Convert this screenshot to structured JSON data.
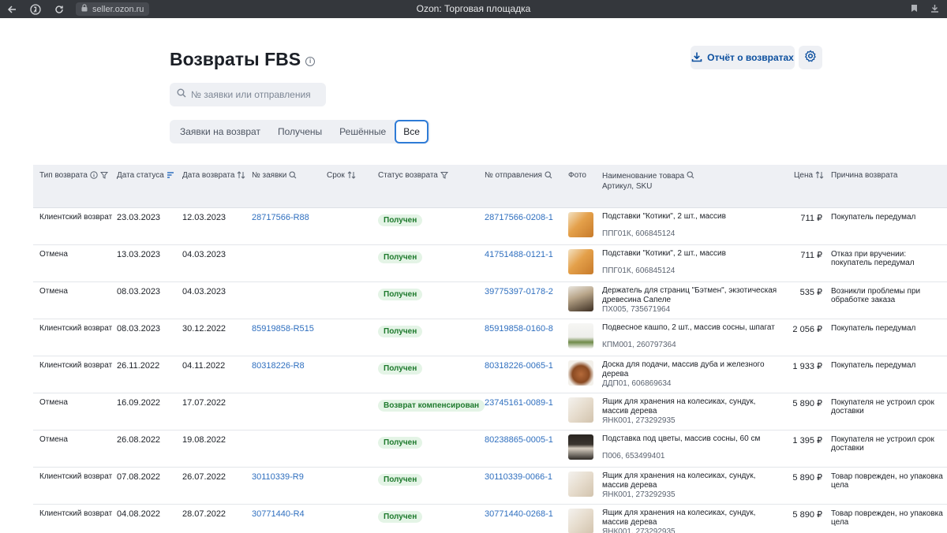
{
  "browser": {
    "url": "seller.ozon.ru",
    "title": "Ozon: Торговая площадка"
  },
  "page": {
    "title": "Возвраты FBS",
    "report_button": "Отчёт о возвратах",
    "search_placeholder": "№ заявки или отправления",
    "tabs": [
      {
        "label": "Заявки на возврат",
        "active": false
      },
      {
        "label": "Получены",
        "active": false
      },
      {
        "label": "Решённые",
        "active": false
      },
      {
        "label": "Все",
        "active": true
      }
    ]
  },
  "table": {
    "headers": {
      "type": "Тип возврата",
      "status_date": "Дата статуса",
      "return_date": "Дата возврата",
      "request_no": "№ заявки",
      "term": "Срок",
      "status": "Статус возврата",
      "shipment_no": "№ отправления",
      "photo": "Фото",
      "product": "Наименование товара",
      "product_sub": "Артикул, SKU",
      "price": "Цена",
      "reason": "Причина возврата"
    },
    "rows": [
      {
        "type": "Клиентский возврат",
        "status_date": "23.03.2023",
        "return_date": "12.03.2023",
        "request_no": "28717566-R88",
        "status": "Получен",
        "shipment_no": "28717566-0208-1",
        "product": "Подставки \"Котики\", 2 шт., массив",
        "sku": "ППГ01К, 606845124",
        "price": "711 ₽",
        "reason": "Покупатель передумал"
      },
      {
        "type": "Отмена",
        "status_date": "13.03.2023",
        "return_date": "04.03.2023",
        "request_no": "",
        "status": "Получен",
        "shipment_no": "41751488-0121-1",
        "product": "Подставки \"Котики\", 2 шт., массив",
        "sku": "ППГ01К, 606845124",
        "price": "711 ₽",
        "reason": "Отказ при вручении: покупатель передумал"
      },
      {
        "type": "Отмена",
        "status_date": "08.03.2023",
        "return_date": "04.03.2023",
        "request_no": "",
        "status": "Получен",
        "shipment_no": "39775397-0178-2",
        "product": "Держатель для страниц \"Бэтмен\", экзотическая древесина Сапеле",
        "sku": "ПХ005, 735671964",
        "price": "535 ₽",
        "reason": "Возникли проблемы при обработке заказа"
      },
      {
        "type": "Клиентский возврат",
        "status_date": "08.03.2023",
        "return_date": "30.12.2022",
        "request_no": "85919858-R515",
        "status": "Получен",
        "shipment_no": "85919858-0160-8",
        "product": "Подвесное кашпо, 2 шт., массив сосны, шпагат",
        "sku": "КПМ001, 260797364",
        "price": "2 056 ₽",
        "reason": "Покупатель передумал"
      },
      {
        "type": "Клиентский возврат",
        "status_date": "26.11.2022",
        "return_date": "04.11.2022",
        "request_no": "80318226-R8",
        "status": "Получен",
        "shipment_no": "80318226-0065-1",
        "product": "Доска для подачи, массив дуба и железного дерева",
        "sku": "ДДП01, 606869634",
        "price": "1 933 ₽",
        "reason": "Покупатель передумал"
      },
      {
        "type": "Отмена",
        "status_date": "16.09.2022",
        "return_date": "17.07.2022",
        "request_no": "",
        "status": "Возврат компенсирован",
        "shipment_no": "23745161-0089-1",
        "product": "Ящик для хранения на колесиках, сундук, массив дерева",
        "sku": "ЯНК001, 273292935",
        "price": "5 890 ₽",
        "reason": "Покупателя не устроил срок доставки"
      },
      {
        "type": "Отмена",
        "status_date": "26.08.2022",
        "return_date": "19.08.2022",
        "request_no": "",
        "status": "Получен",
        "shipment_no": "80238865-0005-1",
        "product": "Подставка под цветы, массив сосны, 60 см",
        "sku": "П006, 653499401",
        "price": "1 395 ₽",
        "reason": "Покупателя не устроил срок доставки"
      },
      {
        "type": "Клиентский возврат",
        "status_date": "07.08.2022",
        "return_date": "26.07.2022",
        "request_no": "30110339-R9",
        "status": "Получен",
        "shipment_no": "30110339-0066-1",
        "product": "Ящик для хранения на колесиках, сундук, массив дерева",
        "sku": "ЯНК001, 273292935",
        "price": "5 890 ₽",
        "reason": "Товар поврежден, но упаковка цела"
      },
      {
        "type": "Клиентский возврат",
        "status_date": "04.08.2022",
        "return_date": "28.07.2022",
        "request_no": "30771440-R4",
        "status": "Получен",
        "shipment_no": "30771440-0268-1",
        "product": "Ящик для хранения на колесиках, сундук, массив дерева",
        "sku": "ЯНК001, 273292935",
        "price": "5 890 ₽",
        "reason": "Товар поврежден, но упаковка цела"
      }
    ]
  }
}
